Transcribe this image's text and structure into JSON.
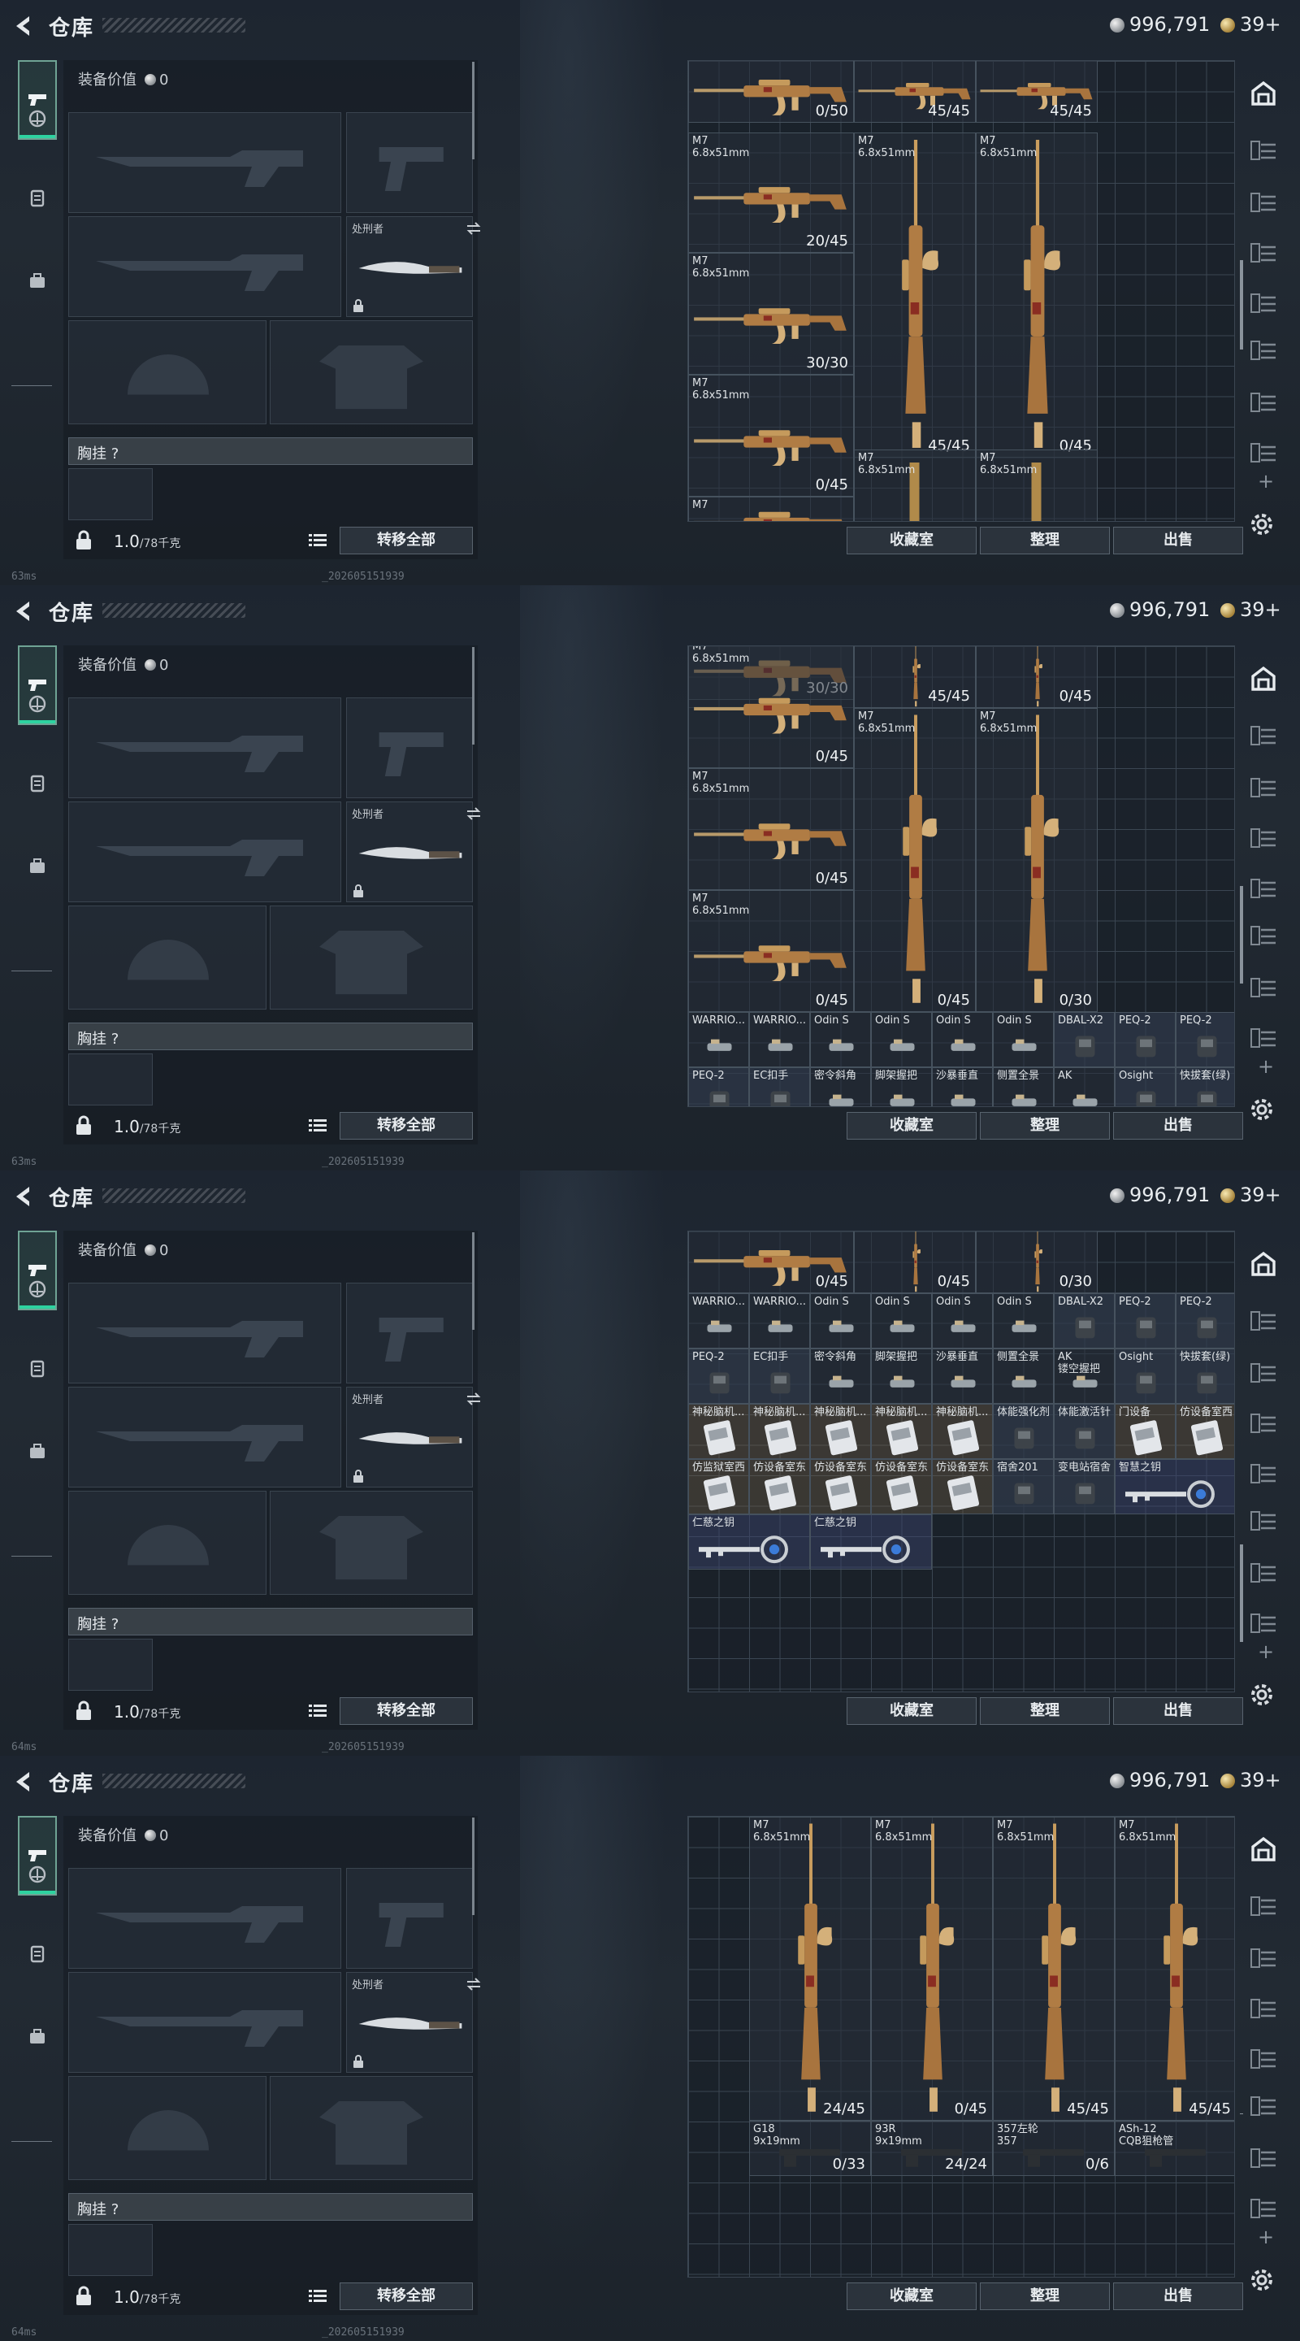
{
  "panels": [
    {
      "title": "仓库",
      "currency": {
        "silver": "996,791",
        "gold": "39+"
      },
      "equip_value_label": "装备价值",
      "equip_value": "0",
      "melee_label": "处刑者",
      "chest_label": "胸挂 ?",
      "weight": "1.0",
      "weight_max": "/78千克",
      "transfer_all": "转移全部",
      "buttons": {
        "collection": "收藏室",
        "sort": "整理",
        "sell": "出售"
      },
      "ping": "63ms",
      "build_id": "_202605151939",
      "stash_items": [
        {
          "name": "",
          "count": "0/50"
        },
        {
          "name": "",
          "count": "45/45"
        },
        {
          "name": "",
          "count": "45/45"
        },
        {
          "name": "M7\n6.8x51mm",
          "count": "20/45"
        },
        {
          "name": "M7\n6.8x51mm",
          "count": "45/45"
        },
        {
          "name": "M7\n6.8x51mm",
          "count": "0/45"
        },
        {
          "name": "M7\n6.8x51mm",
          "count": "30/30"
        },
        {
          "name": "M7\n6.8x51mm",
          "count": "0/45"
        },
        {
          "name": "M7\n6.8x51mm",
          "count": ""
        },
        {
          "name": "M7\n6.8x51mm",
          "count": ""
        },
        {
          "name": "M7",
          "count": ""
        }
      ]
    },
    {
      "title": "仓库",
      "currency": {
        "silver": "996,791",
        "gold": "39+"
      },
      "equip_value_label": "装备价值",
      "equip_value": "0",
      "melee_label": "处刑者",
      "chest_label": "胸挂 ?",
      "weight": "1.0",
      "weight_max": "/78千克",
      "transfer_all": "转移全部",
      "buttons": {
        "collection": "收藏室",
        "sort": "整理",
        "sell": "出售"
      },
      "ping": "63ms",
      "build_id": "_202605151939",
      "stash_items": [
        {
          "name": "",
          "count": "30/30"
        },
        {
          "name": "M7\n6.8x51mm",
          "count": "0/45"
        },
        {
          "name": "",
          "count": "45/45"
        },
        {
          "name": "",
          "count": "0/45"
        },
        {
          "name": "M7\n6.8x51mm",
          "count": "0/45"
        },
        {
          "name": "M7\n6.8x51mm",
          "count": "0/45"
        },
        {
          "name": "M7\n6.8x51mm",
          "count": "0/30"
        },
        {
          "name": "M7\n6.8x51mm",
          "count": "0/45"
        },
        {
          "name": "WARRIO...",
          "count": ""
        },
        {
          "name": "WARRIO...",
          "count": ""
        },
        {
          "name": "Odin S",
          "count": ""
        },
        {
          "name": "Odin S",
          "count": ""
        },
        {
          "name": "Odin S",
          "count": ""
        },
        {
          "name": "Odin S",
          "count": ""
        },
        {
          "name": "DBAL-X2",
          "count": ""
        },
        {
          "name": "PEQ-2",
          "count": ""
        },
        {
          "name": "PEQ-2",
          "count": ""
        },
        {
          "name": "PEQ-2",
          "count": ""
        },
        {
          "name": "EC扣手",
          "count": ""
        },
        {
          "name": "密令斜角",
          "count": ""
        },
        {
          "name": "脚架握把",
          "count": ""
        },
        {
          "name": "沙暴垂直",
          "count": ""
        },
        {
          "name": "侧置全景",
          "count": ""
        },
        {
          "name": "AK",
          "count": ""
        },
        {
          "name": "Osight",
          "count": ""
        },
        {
          "name": "快拔套(绿)",
          "count": ""
        }
      ]
    },
    {
      "title": "仓库",
      "currency": {
        "silver": "996,791",
        "gold": "39+"
      },
      "equip_value_label": "装备价值",
      "equip_value": "0",
      "melee_label": "处刑者",
      "chest_label": "胸挂 ?",
      "weight": "1.0",
      "weight_max": "/78千克",
      "transfer_all": "转移全部",
      "buttons": {
        "collection": "收藏室",
        "sort": "整理",
        "sell": "出售"
      },
      "ping": "64ms",
      "build_id": "_202605151939",
      "stash_items": [
        {
          "name": "",
          "count": "0/45"
        },
        {
          "name": "",
          "count": "0/45"
        },
        {
          "name": "",
          "count": "0/30"
        },
        {
          "name": "WARRIO...",
          "count": ""
        },
        {
          "name": "WARRIO...",
          "count": ""
        },
        {
          "name": "Odin S",
          "count": ""
        },
        {
          "name": "Odin S",
          "count": ""
        },
        {
          "name": "Odin S",
          "count": ""
        },
        {
          "name": "Odin S",
          "count": ""
        },
        {
          "name": "DBAL-X2",
          "count": ""
        },
        {
          "name": "PEQ-2",
          "count": ""
        },
        {
          "name": "PEQ-2",
          "count": ""
        },
        {
          "name": "PEQ-2",
          "count": ""
        },
        {
          "name": "EC扣手",
          "count": ""
        },
        {
          "name": "密令斜角",
          "count": ""
        },
        {
          "name": "脚架握把",
          "count": ""
        },
        {
          "name": "沙暴垂直",
          "count": ""
        },
        {
          "name": "侧置全景",
          "count": ""
        },
        {
          "name": "AK\n镂空握把",
          "count": ""
        },
        {
          "name": "Osight",
          "count": ""
        },
        {
          "name": "快拔套(绿)",
          "count": ""
        },
        {
          "name": "神秘脑机...",
          "count": ""
        },
        {
          "name": "神秘脑机...",
          "count": ""
        },
        {
          "name": "神秘脑机...",
          "count": ""
        },
        {
          "name": "神秘脑机...",
          "count": ""
        },
        {
          "name": "神秘脑机...",
          "count": ""
        },
        {
          "name": "体能强化剂",
          "count": ""
        },
        {
          "name": "体能激活针",
          "count": ""
        },
        {
          "name": "门设备",
          "count": ""
        },
        {
          "name": "仿设备室西",
          "count": ""
        },
        {
          "name": "仿监狱室西",
          "count": ""
        },
        {
          "name": "仿设备室东",
          "count": ""
        },
        {
          "name": "仿设备室东",
          "count": ""
        },
        {
          "name": "仿设备室东",
          "count": ""
        },
        {
          "name": "仿设备室东",
          "count": ""
        },
        {
          "name": "宿舍201",
          "count": ""
        },
        {
          "name": "变电站宿舍",
          "count": ""
        },
        {
          "name": "智慧之钥",
          "count": ""
        },
        {
          "name": "仁慈之钥",
          "count": ""
        },
        {
          "name": "仁慈之钥",
          "count": ""
        }
      ]
    },
    {
      "title": "仓库",
      "currency": {
        "silver": "996,791",
        "gold": "39+"
      },
      "equip_value_label": "装备价值",
      "equip_value": "0",
      "melee_label": "处刑者",
      "chest_label": "胸挂 ?",
      "weight": "1.0",
      "weight_max": "/78千克",
      "transfer_all": "转移全部",
      "buttons": {
        "collection": "收藏室",
        "sort": "整理",
        "sell": "出售"
      },
      "ping": "64ms",
      "build_id": "_202605151939",
      "stash_items": [
        {
          "name": "M7\n6.8x51mm",
          "count": "24/45"
        },
        {
          "name": "M7\n6.8x51mm",
          "count": "0/45"
        },
        {
          "name": "M7\n6.8x51mm",
          "count": "45/45"
        },
        {
          "name": "M7\n6.8x51mm",
          "count": "45/45"
        },
        {
          "name": "G18\n9x19mm",
          "count": "0/33"
        },
        {
          "name": "93R\n9x19mm",
          "count": "24/24"
        },
        {
          "name": "357左轮\n357",
          "count": "0/6"
        },
        {
          "name": "ASh-12\nCQB狙枪管",
          "count": ""
        }
      ]
    }
  ]
}
